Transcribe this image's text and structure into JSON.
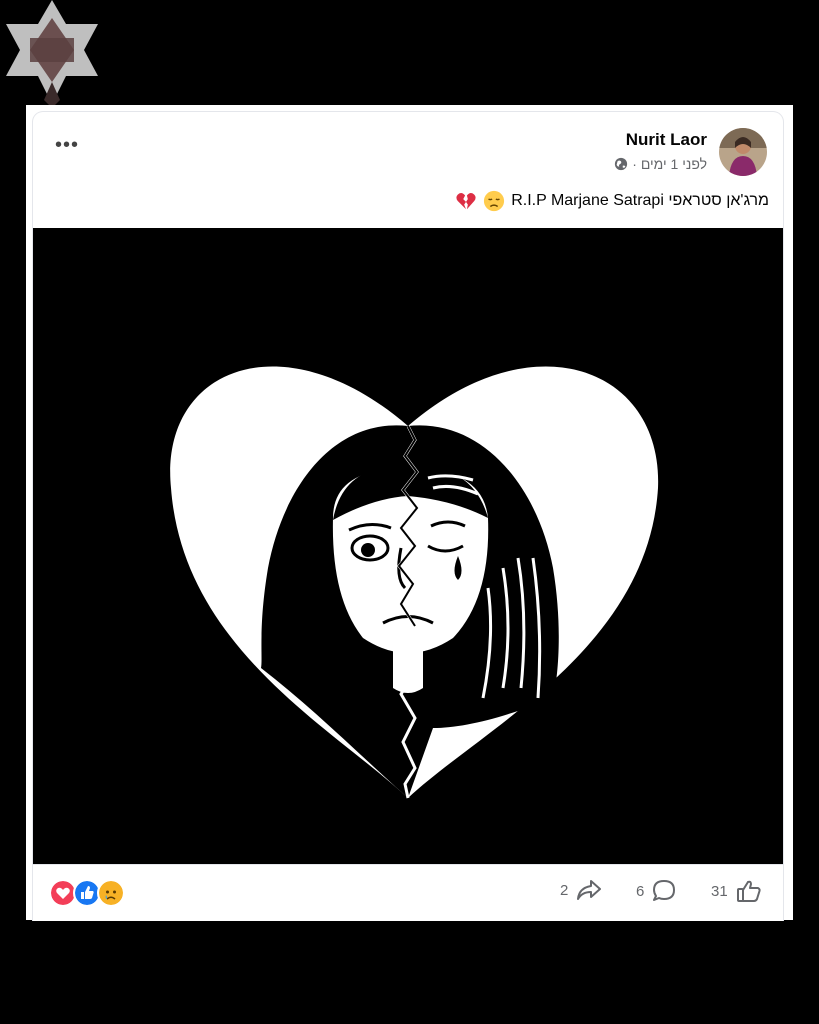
{
  "post": {
    "author": "Nurit Laor",
    "time": "לפני 1 ימים ·",
    "caption_text": "מרג'אן סטראפי R.I.P Marjane Satrapi",
    "caption_emojis": [
      "disappointed-face-emoji",
      "broken-heart-emoji"
    ],
    "more_label": "•••"
  },
  "footer": {
    "reactions": [
      "love-reaction-icon",
      "like-reaction-icon",
      "sad-reaction-icon"
    ],
    "likes": "31",
    "comments": "6",
    "shares": "2"
  },
  "colors": {
    "like_blue": "#1877f2",
    "love_red": "#f33e58",
    "sad_yellow": "#f7b125",
    "meta_gray": "#65676b"
  }
}
